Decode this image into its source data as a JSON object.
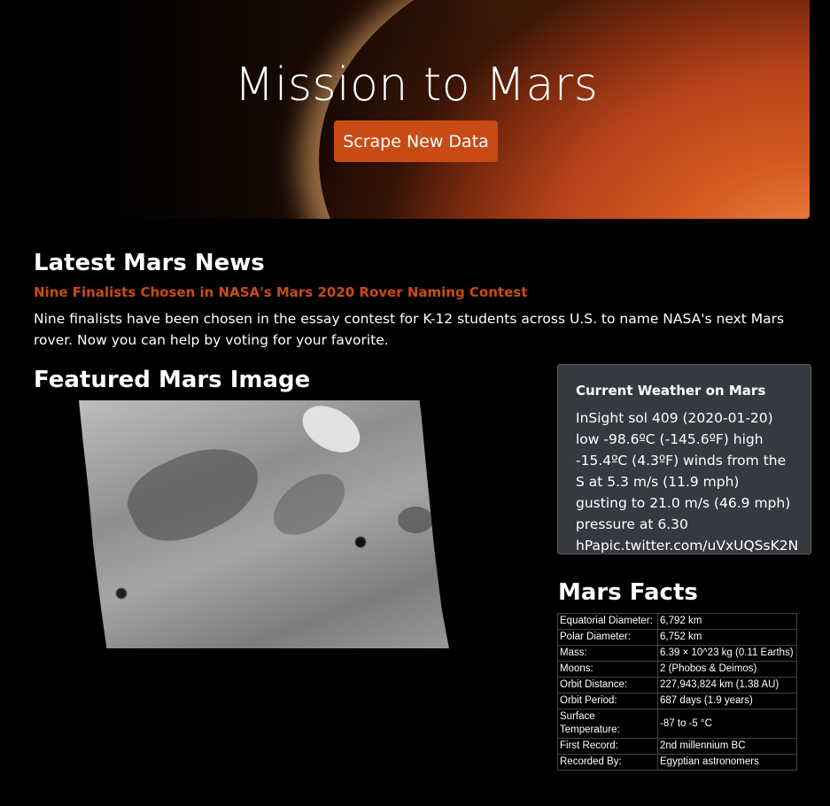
{
  "hero": {
    "title": "Mission to Mars",
    "button_label": "Scrape New Data"
  },
  "news": {
    "heading": "Latest Mars News",
    "title": "Nine Finalists Chosen in NASA's Mars 2020 Rover Naming Contest",
    "paragraph": "Nine finalists have been chosen in the essay contest for K-12 students across U.S. to name NASA's next Mars rover. Now you can help by voting for your favorite."
  },
  "featured": {
    "heading": "Featured Mars Image"
  },
  "weather": {
    "heading": "Current Weather on Mars",
    "text": "InSight sol 409 (2020-01-20) low -98.6ºC (-145.6ºF) high -15.4ºC (4.3ºF) winds from the S at 5.3 m/s (11.9 mph) gusting to 21.0 m/s (46.9 mph) pressure at 6.30 hPapic.twitter.com/uVxUQSsK2N"
  },
  "facts": {
    "heading": "Mars Facts",
    "rows": [
      {
        "key": "Equatorial Diameter:",
        "value": "6,792 km"
      },
      {
        "key": "Polar Diameter:",
        "value": "6,752 km"
      },
      {
        "key": "Mass:",
        "value": "6.39 × 10^23 kg (0.11 Earths)"
      },
      {
        "key": "Moons:",
        "value": "2 (Phobos & Deimos)"
      },
      {
        "key": "Orbit Distance:",
        "value": "227,943,824 km (1.38 AU)"
      },
      {
        "key": "Orbit Period:",
        "value": "687 days (1.9 years)"
      },
      {
        "key": "Surface Temperature:",
        "value": "-87 to -5 °C"
      },
      {
        "key": "First Record:",
        "value": "2nd millennium BC"
      },
      {
        "key": "Recorded By:",
        "value": "Egyptian astronomers"
      }
    ]
  },
  "colors": {
    "accent": "#c84b16",
    "card_bg": "#343a40",
    "page_bg": "#000000"
  }
}
